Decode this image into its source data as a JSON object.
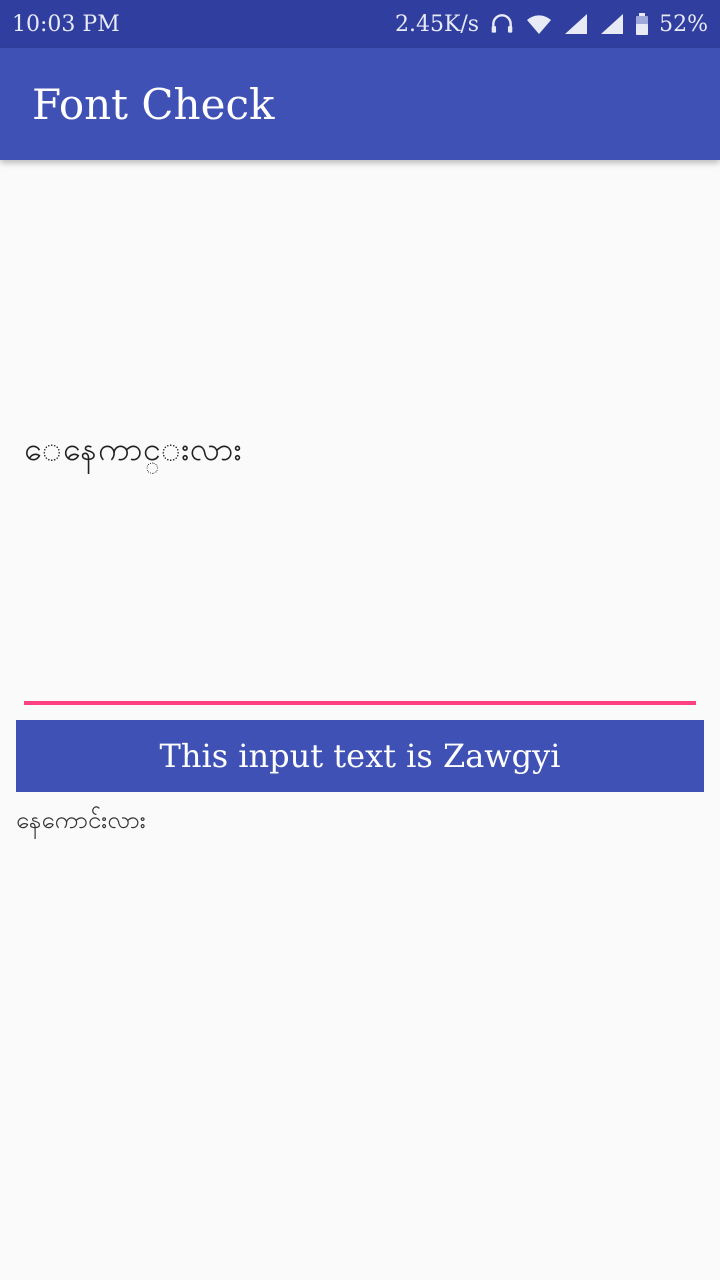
{
  "status_bar": {
    "time": "10:03 PM",
    "net_speed": "2.45K/s",
    "battery": "52%",
    "icons": [
      "headphones-icon",
      "wifi-icon",
      "signal-icon",
      "signal-icon",
      "battery-icon"
    ]
  },
  "app_bar": {
    "title": "Font Check"
  },
  "input": {
    "value": "ေနေကာင္းလား"
  },
  "button": {
    "label": "This input text is Zawgyi"
  },
  "output": {
    "text": "နေကောင်းလား"
  },
  "colors": {
    "status_bar": "#303f9f",
    "primary": "#3f51b5",
    "accent": "#ff4081",
    "background": "#fafafa"
  }
}
